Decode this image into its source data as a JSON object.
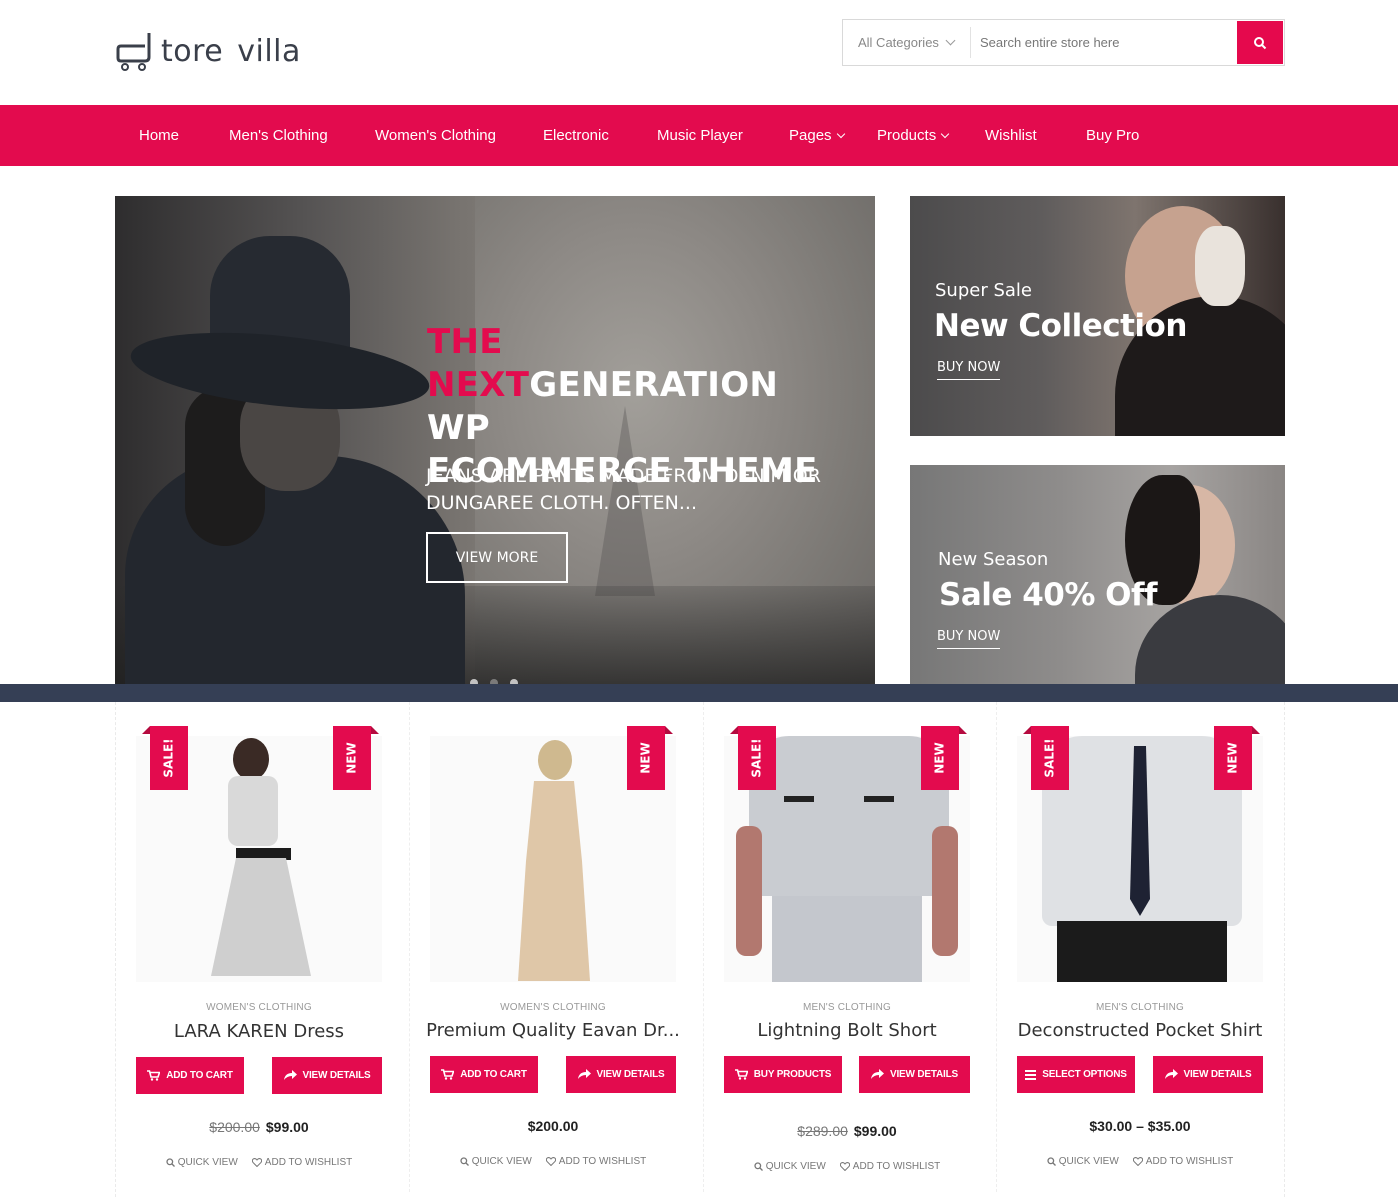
{
  "brand": {
    "logo_text_a": "tore",
    "logo_text_b": "villa"
  },
  "search": {
    "category": "All Categories",
    "placeholder": "Search entire store here"
  },
  "nav": {
    "items": [
      "Home",
      "Men's Clothing",
      "Women's Clothing",
      "Electronic",
      "Music Player",
      "Pages",
      "Products",
      "Wishlist",
      "Buy Pro"
    ]
  },
  "hero": {
    "title_pink_1": "THE",
    "title_pink_2": "NEXT",
    "title_white_1": "GENERATION WP",
    "title_white_2": "ECOMMERCE THEME",
    "subtitle": "JEANS ARE PANTS MADE FROM DENIM OR DUNGAREE CLOTH. OFTEN...",
    "button": "VIEW MORE"
  },
  "promos": [
    {
      "label": "Super Sale",
      "title": "New Collection",
      "button": "BUY NOW"
    },
    {
      "label": "New Season",
      "title": "Sale 40% Off",
      "button": "BUY NOW"
    }
  ],
  "badges": {
    "sale": "SALE!",
    "new": "NEW"
  },
  "products": [
    {
      "category": "WOMEN'S CLOTHING",
      "name": "LARA KAREN Dress",
      "btn1": "ADD TO CART",
      "btn2": "VIEW DETAILS",
      "old_price": "$200.00",
      "price": "$99.00",
      "quick_view": "QUICK VIEW",
      "wishlist": "ADD TO WISHLIST"
    },
    {
      "category": "WOMEN'S CLOTHING",
      "name": "Premium Quality Eavan Dr...",
      "btn1": "ADD TO CART",
      "btn2": "VIEW DETAILS",
      "old_price": "",
      "price": "$200.00",
      "quick_view": "QUICK VIEW",
      "wishlist": "ADD TO WISHLIST"
    },
    {
      "category": "MEN'S CLOTHING",
      "name": "Lightning Bolt Short",
      "btn1": "BUY PRODUCTS",
      "btn2": "VIEW DETAILS",
      "old_price": "$289.00",
      "price": "$99.00",
      "quick_view": "QUICK VIEW",
      "wishlist": "ADD TO WISHLIST"
    },
    {
      "category": "MEN'S CLOTHING",
      "name": "Deconstructed Pocket Shirt",
      "btn1": "SELECT OPTIONS",
      "btn2": "VIEW DETAILS",
      "old_price": "",
      "price": "$30.00 – $35.00",
      "quick_view": "QUICK VIEW",
      "wishlist": "ADD TO WISHLIST"
    }
  ],
  "colors": {
    "accent": "#e30b4e",
    "strip": "#353f55"
  }
}
